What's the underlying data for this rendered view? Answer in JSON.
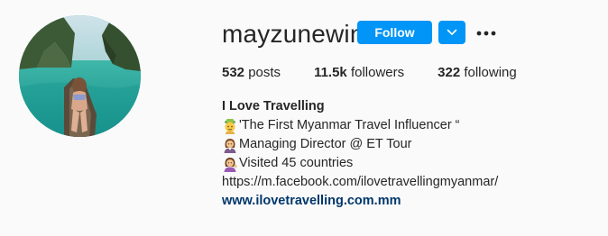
{
  "profile": {
    "username": "mayzunewin",
    "follow_label": "Follow",
    "stats": {
      "posts_count": "532",
      "posts_label": "posts",
      "followers_count": "11.5k",
      "followers_label": "followers",
      "following_count": "322",
      "following_label": "following"
    },
    "bio": {
      "name": "I Love Travelling",
      "lines": [
        {
          "icon": "person-with-hat-emoji",
          "text": "'The First Myanmar Travel Influencer “"
        },
        {
          "icon": "woman-office-worker-emoji",
          "text": "Managing Director @ ET Tour"
        },
        {
          "icon": "woman-tipping-hand-emoji",
          "text": " Visited 45 countries"
        }
      ],
      "facebook_link": "https://m.facebook.com/ilovetravellingmyanmar/",
      "website": "www.ilovetravelling.com.mm"
    }
  },
  "colors": {
    "accent": "#0095f6",
    "link": "#00376b",
    "text": "#262626",
    "background": "#fafafa"
  },
  "icons": {
    "dropdown": "chevron-down-icon",
    "more": "more-options-icon"
  }
}
